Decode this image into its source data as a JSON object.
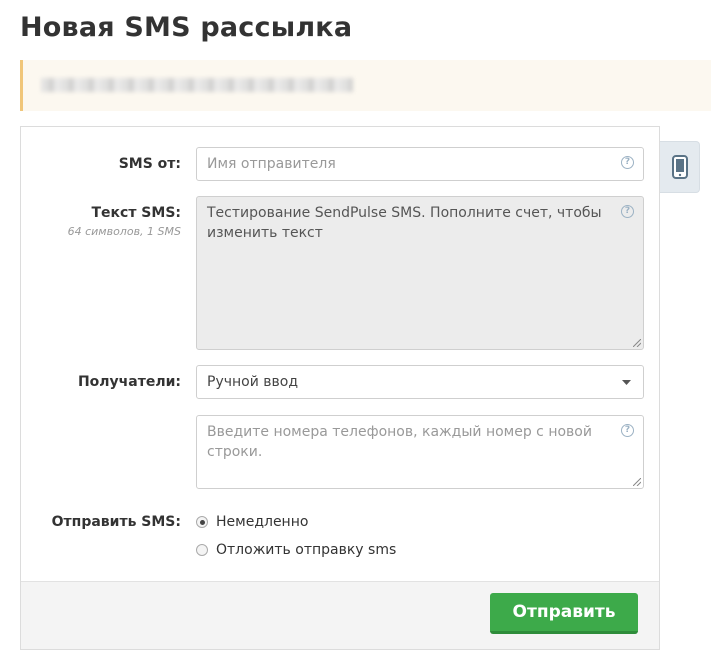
{
  "page": {
    "title": "Новая SMS рассылка"
  },
  "form": {
    "sender": {
      "label": "SMS от:",
      "placeholder": "Имя отправителя"
    },
    "text": {
      "label": "Текст SMS:",
      "counter": "64 символов, 1 SMS",
      "value": "Тестирование SendPulse SMS. Пополните счет, чтобы изменить текст"
    },
    "recipients": {
      "label": "Получатели:",
      "selected": "Ручной ввод",
      "phones_placeholder": "Введите номера телефонов, каждый номер с новой строки."
    },
    "send_time": {
      "label": "Отправить SMS:",
      "options": [
        {
          "label": "Немедленно",
          "checked": true
        },
        {
          "label": "Отложить отправку sms",
          "checked": false
        }
      ]
    },
    "submit_label": "Отправить"
  },
  "icons": {
    "help": "question-circle-icon",
    "side_tab": "phone-icon",
    "dropdown": "caret-down-icon"
  },
  "colors": {
    "accent_green": "#3daa4a",
    "notice_border": "#f0c67a",
    "help_icon": "#9cb2c4"
  }
}
